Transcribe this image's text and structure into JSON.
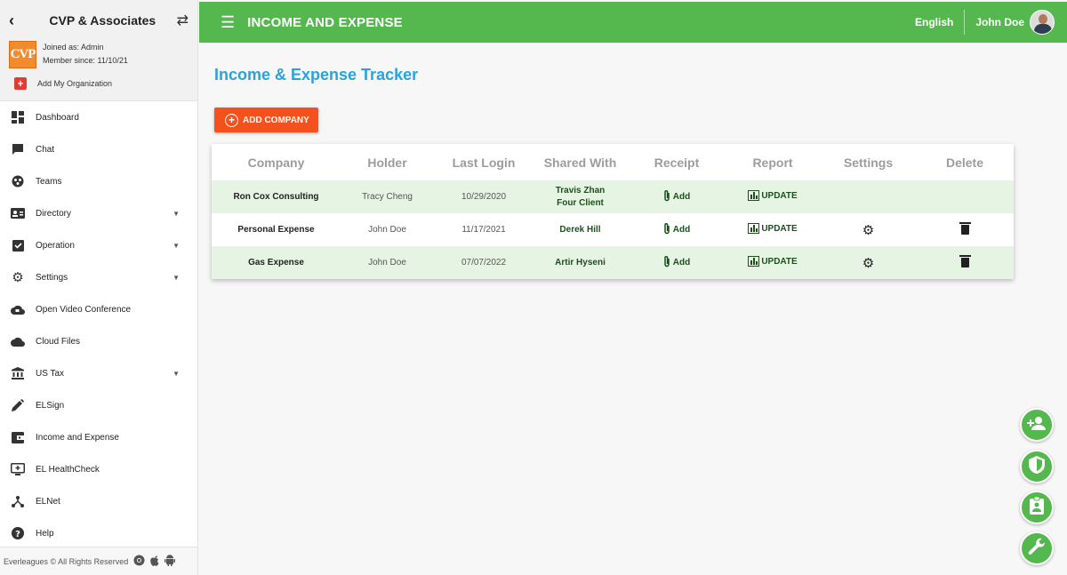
{
  "sidebar": {
    "org_name": "CVP & Associates",
    "logo_text": "CVP",
    "joined_as": "Joined as: Admin",
    "member_since": "Member since: 11/10/21",
    "add_org_label": "Add My Organization",
    "items": [
      {
        "label": "Dashboard",
        "icon": "dashboard-icon"
      },
      {
        "label": "Chat",
        "icon": "chat-icon"
      },
      {
        "label": "Teams",
        "icon": "teams-icon"
      },
      {
        "label": "Directory",
        "icon": "directory-icon"
      },
      {
        "label": "Operation",
        "icon": "operation-icon"
      },
      {
        "label": "Settings",
        "icon": "settings-icon"
      },
      {
        "label": "Open Video Conference",
        "icon": "cloud-video-icon"
      },
      {
        "label": "Cloud Files",
        "icon": "cloud-icon"
      },
      {
        "label": "US Tax",
        "icon": "bank-icon"
      },
      {
        "label": "ELSign",
        "icon": "pen-icon"
      },
      {
        "label": "Income and Expense",
        "icon": "wallet-icon"
      },
      {
        "label": "EL HealthCheck",
        "icon": "monitor-plus-icon"
      },
      {
        "label": "ELNet",
        "icon": "network-icon"
      },
      {
        "label": "Help",
        "icon": "help-icon"
      }
    ],
    "footer": "Everleagues © All Rights Reserved"
  },
  "topbar": {
    "title": "INCOME AND EXPENSE",
    "language": "English",
    "user_name": "John Doe"
  },
  "main": {
    "page_title": "Income & Expense Tracker",
    "add_company_label": "ADD COMPANY",
    "table": {
      "headers": [
        "Company",
        "Holder",
        "Last Login",
        "Shared With",
        "Receipt",
        "Report",
        "Settings",
        "Delete"
      ],
      "receipt_label": "Add",
      "report_label": "UPDATE",
      "rows": [
        {
          "company": "Ron Cox Consulting",
          "holder": "Tracy Cheng",
          "last_login": "10/29/2020",
          "shared_1": "Travis Zhan",
          "shared_2": "Four Client"
        },
        {
          "company": "Personal Expense",
          "holder": "John Doe",
          "last_login": "11/17/2021",
          "shared_1": "Derek Hill",
          "shared_2": ""
        },
        {
          "company": "Gas Expense",
          "holder": "John Doe",
          "last_login": "07/07/2022",
          "shared_1": "Artir Hyseni",
          "shared_2": ""
        }
      ]
    }
  },
  "colors": {
    "brand_green": "#55b84f",
    "title_blue": "#2aa3d9",
    "action_orange": "#f4511e",
    "row_highlight": "#e6f5e3"
  }
}
